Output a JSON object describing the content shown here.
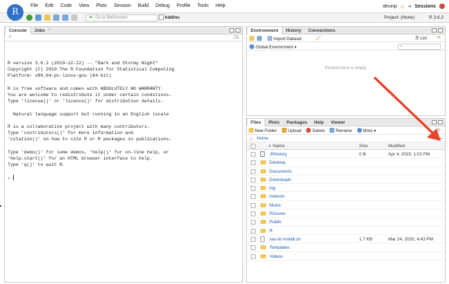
{
  "menubar": {
    "logo_letter": "R",
    "items": [
      "File",
      "Edit",
      "Code",
      "View",
      "Plots",
      "Session",
      "Build",
      "Debug",
      "Profile",
      "Tools",
      "Help"
    ],
    "user": "devinp",
    "sessions": "Sessions"
  },
  "toolbar": {
    "goto_placeholder": "Go to file/function",
    "addins": "Addins",
    "project": "Project: (None)",
    "r_version": "R 3.6.2"
  },
  "console": {
    "tabs": [
      "Console",
      "Jobs"
    ],
    "path": "~/",
    "lines": [
      "R version 3.6.2 (2019-12-12) -- \"Dark and Stormy Night\"",
      "Copyright (C) 2019 The R Foundation for Statistical Computing",
      "Platform: x86_64-pc-linux-gnu (64-bit)",
      "",
      "R is free software and comes with ABSOLUTELY NO WARRANTY.",
      "You are welcome to redistribute it under certain conditions.",
      "Type 'license()' or 'licence()' for distribution details.",
      "",
      "  Natural language support but running in an English locale",
      "",
      "R is a collaborative project with many contributors.",
      "Type 'contributors()' for more information and",
      "'citation()' on how to cite R or R packages in publications.",
      "",
      "Type 'demo()' for some demos, 'help()' for on-line help, or",
      "'help.start()' for an HTML browser interface to help.",
      "Type 'q()' to quit R.",
      ""
    ],
    "prompt": ">"
  },
  "environment": {
    "tabs": [
      "Environment",
      "History",
      "Connections"
    ],
    "import_dataset": "Import Dataset",
    "list_view": "List",
    "scope": "Global Environment",
    "empty_message": "Environment is empty"
  },
  "files": {
    "tabs": [
      "Files",
      "Plots",
      "Packages",
      "Help",
      "Viewer"
    ],
    "new_folder": "New Folder",
    "upload": "Upload",
    "delete": "Delete",
    "rename": "Rename",
    "more": "More",
    "breadcrumb": "Home",
    "more_dots": "...",
    "columns": {
      "name": "Name",
      "size": "Size",
      "modified": "Modified"
    },
    "up_arrow": "▲",
    "rows": [
      {
        "name": ".Rhistory",
        "type": "r",
        "size": "0 B",
        "modified": "Apr 4, 2020, 1:02 PM"
      },
      {
        "name": "Desktop",
        "type": "folder",
        "size": "",
        "modified": ""
      },
      {
        "name": "Documents",
        "type": "folder",
        "size": "",
        "modified": ""
      },
      {
        "name": "Downloads",
        "type": "folder",
        "size": "",
        "modified": ""
      },
      {
        "name": "log",
        "type": "folder",
        "size": "",
        "modified": ""
      },
      {
        "name": "metrum",
        "type": "folder",
        "size": "",
        "modified": ""
      },
      {
        "name": "Music",
        "type": "folder",
        "size": "",
        "modified": ""
      },
      {
        "name": "Pictures",
        "type": "folder",
        "size": "",
        "modified": ""
      },
      {
        "name": "Public",
        "type": "folder",
        "size": "",
        "modified": ""
      },
      {
        "name": "R",
        "type": "folder",
        "size": "",
        "modified": ""
      },
      {
        "name": "sas-lic-install.sh",
        "type": "doc",
        "size": "1.7 KB",
        "modified": "Mar 24, 2020, 4:43 PM"
      },
      {
        "name": "Templates",
        "type": "folder",
        "size": "",
        "modified": ""
      },
      {
        "name": "Videos",
        "type": "folder",
        "size": "",
        "modified": ""
      }
    ]
  },
  "colors": {
    "arrow": "#e8442c",
    "link": "#1a54b8",
    "folder": "#f0c75a",
    "logo": "#2f71c8"
  }
}
